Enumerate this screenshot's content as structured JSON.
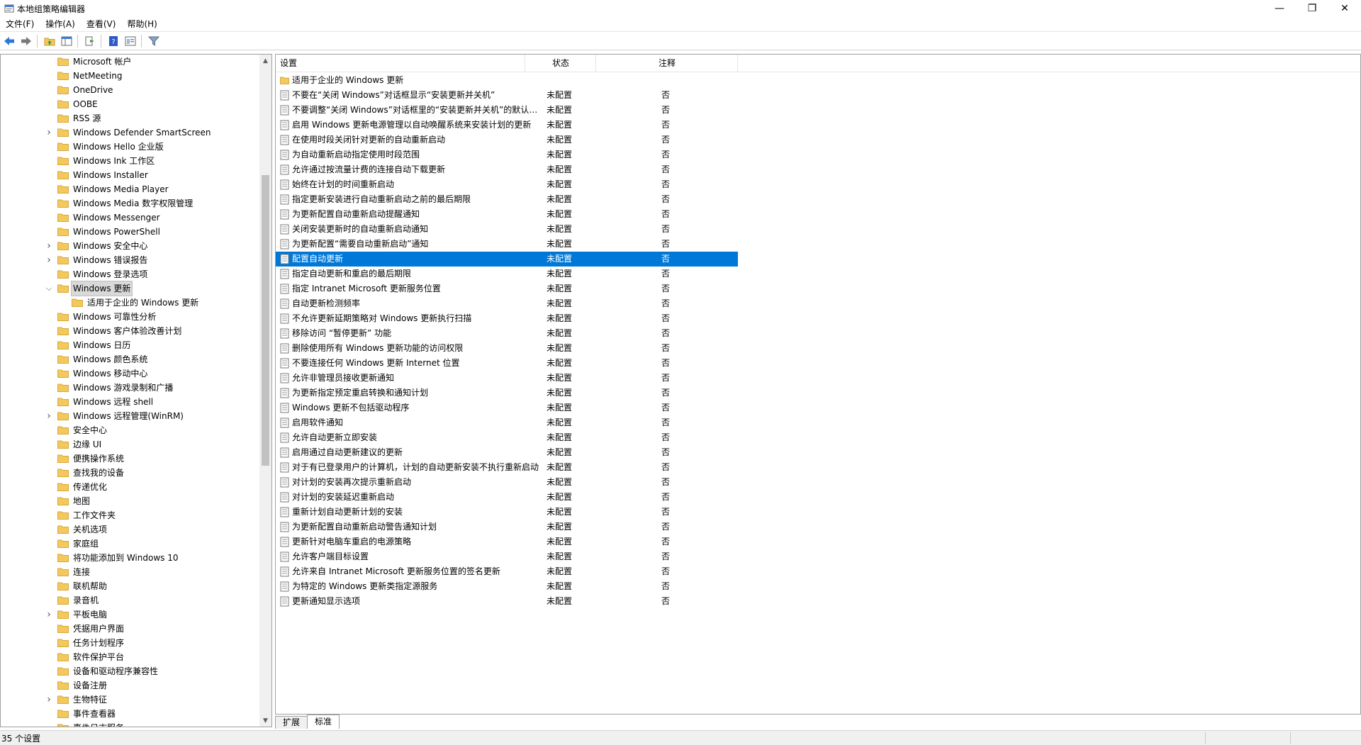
{
  "window": {
    "title": "本地组策略编辑器",
    "minimize": "—",
    "maximize": "❐",
    "close": "✕"
  },
  "menu": [
    "文件(F)",
    "操作(A)",
    "查看(V)",
    "帮助(H)"
  ],
  "toolbar_icons": [
    "back-arrow-icon",
    "forward-arrow-icon",
    "up-folder-icon",
    "show-hide-tree-icon",
    "export-list-icon",
    "help-icon",
    "properties-icon",
    "filter-icon"
  ],
  "tree": {
    "items": [
      {
        "label": "Microsoft 帐户",
        "depth": 0,
        "expandable": false
      },
      {
        "label": "NetMeeting",
        "depth": 0,
        "expandable": false
      },
      {
        "label": "OneDrive",
        "depth": 0,
        "expandable": false
      },
      {
        "label": "OOBE",
        "depth": 0,
        "expandable": false
      },
      {
        "label": "RSS 源",
        "depth": 0,
        "expandable": false
      },
      {
        "label": "Windows Defender SmartScreen",
        "depth": 0,
        "expandable": true
      },
      {
        "label": "Windows Hello 企业版",
        "depth": 0,
        "expandable": false
      },
      {
        "label": "Windows Ink 工作区",
        "depth": 0,
        "expandable": false
      },
      {
        "label": "Windows Installer",
        "depth": 0,
        "expandable": false
      },
      {
        "label": "Windows Media Player",
        "depth": 0,
        "expandable": false
      },
      {
        "label": "Windows Media 数字权限管理",
        "depth": 0,
        "expandable": false
      },
      {
        "label": "Windows Messenger",
        "depth": 0,
        "expandable": false
      },
      {
        "label": "Windows PowerShell",
        "depth": 0,
        "expandable": false
      },
      {
        "label": "Windows 安全中心",
        "depth": 0,
        "expandable": true
      },
      {
        "label": "Windows 错误报告",
        "depth": 0,
        "expandable": true
      },
      {
        "label": "Windows 登录选项",
        "depth": 0,
        "expandable": false
      },
      {
        "label": "Windows 更新",
        "depth": 0,
        "expandable": true,
        "expanded": true,
        "selected": true
      },
      {
        "label": "适用于企业的 Windows 更新",
        "depth": 1,
        "expandable": false
      },
      {
        "label": "Windows 可靠性分析",
        "depth": 0,
        "expandable": false
      },
      {
        "label": "Windows 客户体验改善计划",
        "depth": 0,
        "expandable": false
      },
      {
        "label": "Windows 日历",
        "depth": 0,
        "expandable": false
      },
      {
        "label": "Windows 颜色系统",
        "depth": 0,
        "expandable": false
      },
      {
        "label": "Windows 移动中心",
        "depth": 0,
        "expandable": false
      },
      {
        "label": "Windows 游戏录制和广播",
        "depth": 0,
        "expandable": false
      },
      {
        "label": "Windows 远程 shell",
        "depth": 0,
        "expandable": false
      },
      {
        "label": "Windows 远程管理(WinRM)",
        "depth": 0,
        "expandable": true
      },
      {
        "label": "安全中心",
        "depth": 0,
        "expandable": false
      },
      {
        "label": "边缘 UI",
        "depth": 0,
        "expandable": false
      },
      {
        "label": "便携操作系统",
        "depth": 0,
        "expandable": false
      },
      {
        "label": "查找我的设备",
        "depth": 0,
        "expandable": false
      },
      {
        "label": "传递优化",
        "depth": 0,
        "expandable": false
      },
      {
        "label": "地图",
        "depth": 0,
        "expandable": false
      },
      {
        "label": "工作文件夹",
        "depth": 0,
        "expandable": false
      },
      {
        "label": "关机选项",
        "depth": 0,
        "expandable": false
      },
      {
        "label": "家庭组",
        "depth": 0,
        "expandable": false
      },
      {
        "label": "将功能添加到 Windows 10",
        "depth": 0,
        "expandable": false
      },
      {
        "label": "连接",
        "depth": 0,
        "expandable": false
      },
      {
        "label": "联机帮助",
        "depth": 0,
        "expandable": false
      },
      {
        "label": "录音机",
        "depth": 0,
        "expandable": false
      },
      {
        "label": "平板电脑",
        "depth": 0,
        "expandable": true
      },
      {
        "label": "凭据用户界面",
        "depth": 0,
        "expandable": false
      },
      {
        "label": "任务计划程序",
        "depth": 0,
        "expandable": false
      },
      {
        "label": "软件保护平台",
        "depth": 0,
        "expandable": false
      },
      {
        "label": "设备和驱动程序兼容性",
        "depth": 0,
        "expandable": false
      },
      {
        "label": "设备注册",
        "depth": 0,
        "expandable": false
      },
      {
        "label": "生物特征",
        "depth": 0,
        "expandable": true
      },
      {
        "label": "事件查看器",
        "depth": 0,
        "expandable": false
      },
      {
        "label": "事件日志服务",
        "depth": 0,
        "expandable": false
      }
    ]
  },
  "list": {
    "columns": [
      "设置",
      "状态",
      "注释"
    ],
    "rows": [
      {
        "name": "适用于企业的 Windows 更新",
        "state": "",
        "comment": "",
        "folder": true
      },
      {
        "name": "不要在“关闭 Windows”对话框显示“安装更新并关机”",
        "state": "未配置",
        "comment": "否"
      },
      {
        "name": "不要调整“关闭 Windows”对话框里的“安装更新并关机”的默认选项",
        "state": "未配置",
        "comment": "否"
      },
      {
        "name": "启用 Windows 更新电源管理以自动唤醒系统来安装计划的更新",
        "state": "未配置",
        "comment": "否"
      },
      {
        "name": "在使用时段关闭针对更新的自动重新启动",
        "state": "未配置",
        "comment": "否"
      },
      {
        "name": "为自动重新启动指定使用时段范围",
        "state": "未配置",
        "comment": "否"
      },
      {
        "name": "允许通过按流量计费的连接自动下载更新",
        "state": "未配置",
        "comment": "否"
      },
      {
        "name": "始终在计划的时间重新启动",
        "state": "未配置",
        "comment": "否"
      },
      {
        "name": "指定更新安装进行自动重新启动之前的最后期限",
        "state": "未配置",
        "comment": "否"
      },
      {
        "name": "为更新配置自动重新启动提醒通知",
        "state": "未配置",
        "comment": "否"
      },
      {
        "name": "关闭安装更新时的自动重新启动通知",
        "state": "未配置",
        "comment": "否"
      },
      {
        "name": "为更新配置“需要自动重新启动”通知",
        "state": "未配置",
        "comment": "否"
      },
      {
        "name": "配置自动更新",
        "state": "未配置",
        "comment": "否",
        "selected": true
      },
      {
        "name": "指定自动更新和重启的最后期限",
        "state": "未配置",
        "comment": "否"
      },
      {
        "name": "指定 Intranet Microsoft 更新服务位置",
        "state": "未配置",
        "comment": "否"
      },
      {
        "name": "自动更新检测频率",
        "state": "未配置",
        "comment": "否"
      },
      {
        "name": "不允许更新延期策略对 Windows 更新执行扫描",
        "state": "未配置",
        "comment": "否"
      },
      {
        "name": "移除访问 “暂停更新” 功能",
        "state": "未配置",
        "comment": "否"
      },
      {
        "name": "删除使用所有 Windows 更新功能的访问权限",
        "state": "未配置",
        "comment": "否"
      },
      {
        "name": "不要连接任何 Windows 更新 Internet 位置",
        "state": "未配置",
        "comment": "否"
      },
      {
        "name": "允许非管理员接收更新通知",
        "state": "未配置",
        "comment": "否"
      },
      {
        "name": "为更新指定预定重启转换和通知计划",
        "state": "未配置",
        "comment": "否"
      },
      {
        "name": "Windows 更新不包括驱动程序",
        "state": "未配置",
        "comment": "否"
      },
      {
        "name": "启用软件通知",
        "state": "未配置",
        "comment": "否"
      },
      {
        "name": "允许自动更新立即安装",
        "state": "未配置",
        "comment": "否"
      },
      {
        "name": "启用通过自动更新建议的更新",
        "state": "未配置",
        "comment": "否"
      },
      {
        "name": "对于有已登录用户的计算机，计划的自动更新安装不执行重新启动",
        "state": "未配置",
        "comment": "否"
      },
      {
        "name": "对计划的安装再次提示重新启动",
        "state": "未配置",
        "comment": "否"
      },
      {
        "name": "对计划的安装延迟重新启动",
        "state": "未配置",
        "comment": "否"
      },
      {
        "name": "重新计划自动更新计划的安装",
        "state": "未配置",
        "comment": "否"
      },
      {
        "name": "为更新配置自动重新启动警告通知计划",
        "state": "未配置",
        "comment": "否"
      },
      {
        "name": "更新针对电脑车重启的电源策略",
        "state": "未配置",
        "comment": "否"
      },
      {
        "name": "允许客户端目标设置",
        "state": "未配置",
        "comment": "否"
      },
      {
        "name": "允许来自 Intranet Microsoft 更新服务位置的签名更新",
        "state": "未配置",
        "comment": "否"
      },
      {
        "name": "为特定的 Windows 更新类指定源服务",
        "state": "未配置",
        "comment": "否"
      },
      {
        "name": "更新通知显示选项",
        "state": "未配置",
        "comment": "否"
      }
    ]
  },
  "tabs": [
    "扩展",
    "标准"
  ],
  "active_tab": "标准",
  "status": {
    "text": "35 个设置"
  },
  "colors": {
    "selection": "#0078d7",
    "folder": "#f3c95d",
    "tree_selected": "#d9d9d9"
  }
}
